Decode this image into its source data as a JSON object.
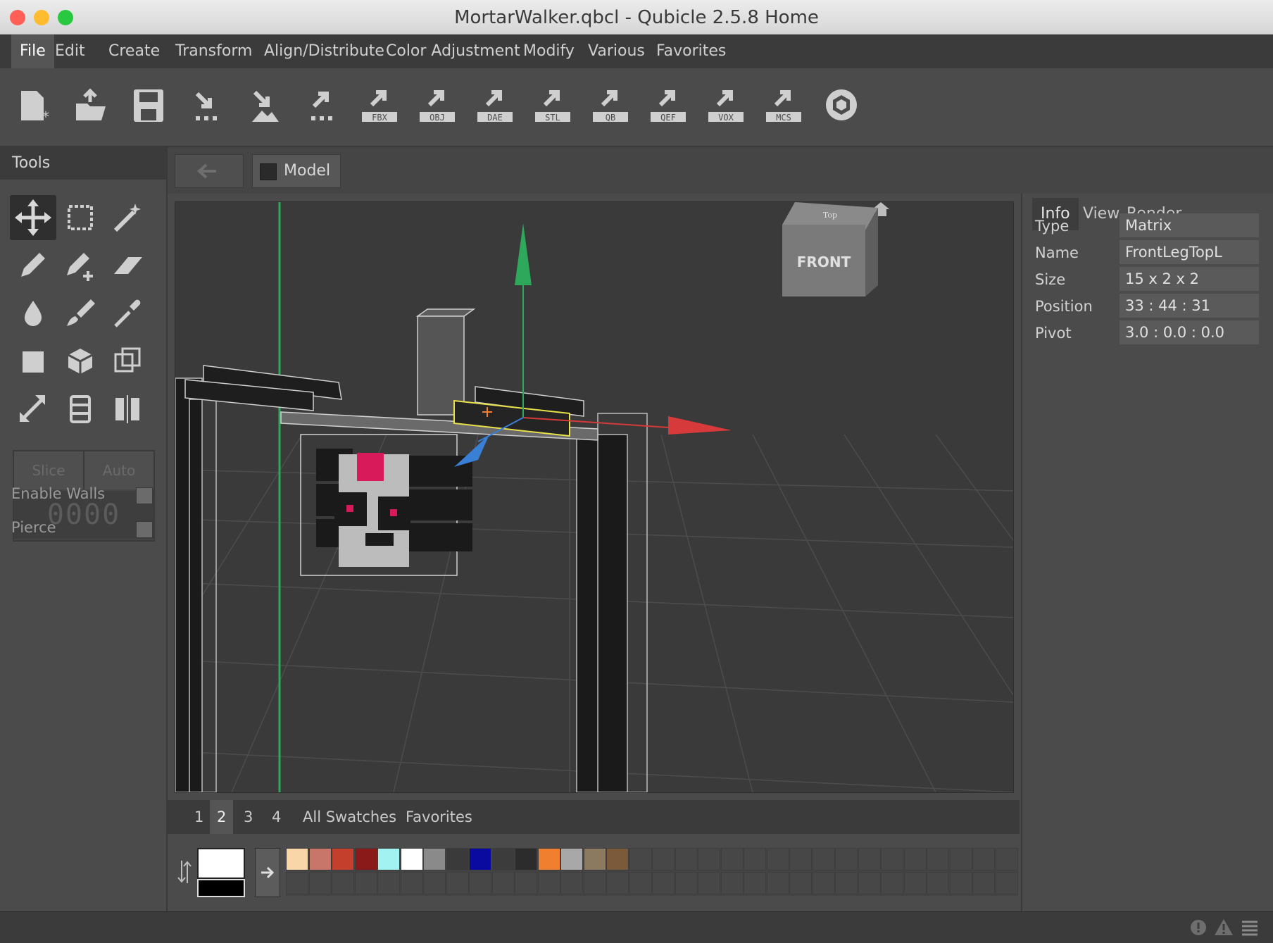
{
  "window": {
    "title": "MortarWalker.qbcl - Qubicle 2.5.8 Home",
    "traffic_lights": [
      "#ff5f57",
      "#febc2e",
      "#28c840"
    ]
  },
  "menu": [
    "File",
    "Edit",
    "Create",
    "Transform",
    "Align/Distribute",
    "Color Adjustment",
    "Modify",
    "Various",
    "Favorites"
  ],
  "toolbar": {
    "buttons": [
      {
        "name": "new-file",
        "label": ""
      },
      {
        "name": "open-file",
        "label": ""
      },
      {
        "name": "save-file",
        "label": ""
      },
      {
        "name": "import",
        "label": ""
      },
      {
        "name": "import-image",
        "label": ""
      },
      {
        "name": "export",
        "label": ""
      },
      {
        "name": "export-fbx",
        "label": "FBX"
      },
      {
        "name": "export-obj",
        "label": "OBJ"
      },
      {
        "name": "export-dae",
        "label": "DAE"
      },
      {
        "name": "export-stl",
        "label": "STL"
      },
      {
        "name": "export-qb",
        "label": "QB"
      },
      {
        "name": "export-qef",
        "label": "QEF"
      },
      {
        "name": "export-vox",
        "label": "VOX"
      },
      {
        "name": "export-mcs",
        "label": "MCS"
      },
      {
        "name": "cube-store",
        "label": ""
      }
    ]
  },
  "tools": {
    "header": "Tools",
    "slice_label": "Slice",
    "auto_label": "Auto",
    "slice_value": "0000",
    "enable_walls": "Enable Walls",
    "pierce": "Pierce"
  },
  "nav": {
    "breadcrumb": "Model"
  },
  "viewport": {
    "nav_cube_front": "FRONT",
    "nav_cube_top": "Top",
    "axis_colors": {
      "x": "#d63a3a",
      "y": "#2ea85a",
      "z": "#3a7fd6"
    },
    "selection_color": "#e8e04a"
  },
  "info_panel": {
    "tabs": [
      "Info",
      "View",
      "Render"
    ],
    "active_tab": "Info",
    "properties": [
      {
        "label": "Type",
        "value": "Matrix"
      },
      {
        "label": "Name",
        "value": "FrontLegTopL"
      },
      {
        "label": "Size",
        "value": "15 x 2 x 2"
      },
      {
        "label": "Position",
        "value": "33 : 44 : 31"
      },
      {
        "label": "Pivot",
        "value": "3.0 : 0.0 : 0.0"
      }
    ]
  },
  "palette": {
    "tabs": [
      "1",
      "2",
      "3",
      "4",
      "All Swatches",
      "Favorites"
    ],
    "active_tab": "2",
    "foreground": "#ffffff",
    "background": "#000000",
    "swatches": [
      "#f9d6a8",
      "#c9766a",
      "#c4402c",
      "#8a1a1a",
      "#a3f2f2",
      "#ffffff",
      "#8a8a8a",
      "#3a3a3a",
      "#0a0aa0",
      "#3c3c3c",
      "#2c2c2c",
      "#f08030",
      "#a8a8a8",
      "#8c7a60",
      "#7a5a3a"
    ]
  }
}
